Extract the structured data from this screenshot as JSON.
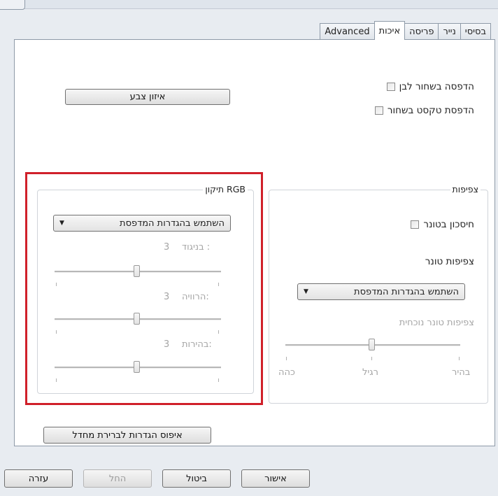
{
  "tabs": [
    {
      "label": "בסיסי",
      "active": false
    },
    {
      "label": "נייר",
      "active": false
    },
    {
      "label": "פריסה",
      "active": false
    },
    {
      "label": "איכות",
      "active": true
    },
    {
      "label": "Advanced",
      "active": false
    }
  ],
  "quality": {
    "color_balance_button": "איזון צבע",
    "bw_print_label": "הדפסה בשחור לבן",
    "black_text_label": "הדפסת טקסט בשחור"
  },
  "density": {
    "legend": "צפיפות",
    "toner_save_label": "חיסכון בטונר",
    "toner_density_title": "צפיפות טונר",
    "select_value": "השתמש בהגדרות המדפסת",
    "current_label": "צפיפות טונר נוכחית",
    "scale": [
      "בהיר",
      "רגיל",
      "כהה"
    ]
  },
  "rgb": {
    "legend": "תיקון RGB",
    "select_value": "השתמש בהגדרות המדפסת",
    "contrast_label": "בניגוד :",
    "contrast_value": "3",
    "saturation_label": "הרוויה:",
    "saturation_value": "3",
    "brightness_label": "בהירות:",
    "brightness_value": "3"
  },
  "reset_button": "איפוס הגדרות לברירת מחדל",
  "footer": {
    "ok": "אישור",
    "cancel": "ביטול",
    "apply": "החל",
    "help": "עזרה"
  }
}
